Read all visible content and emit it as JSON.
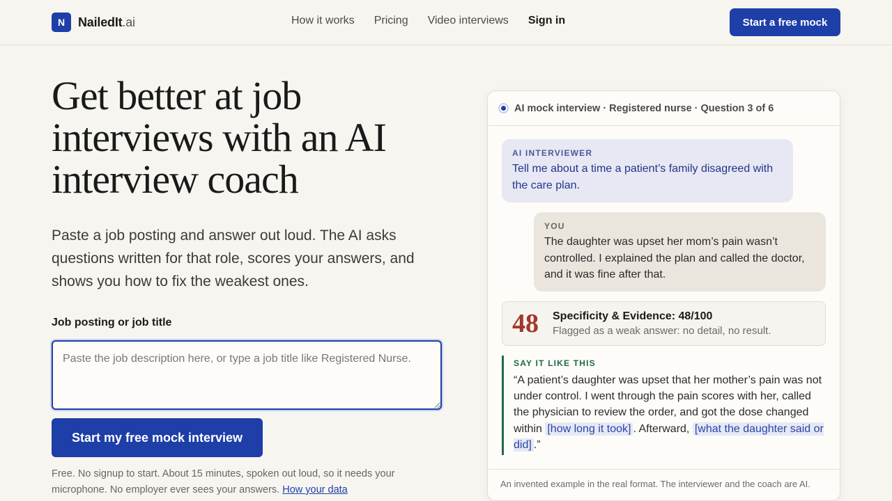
{
  "header": {
    "logo_letter": "N",
    "logo_name": "NailedIt",
    "logo_suffix": ".ai",
    "nav": [
      "How it works",
      "Pricing",
      "Video interviews",
      "Sign in"
    ],
    "cta": "Start a free mock"
  },
  "hero": {
    "title": "Get better at job interviews with an AI interview coach",
    "subtitle": "Paste a job posting and answer out loud. The AI asks questions written for that role, scores your answers, and shows you how to fix the weakest ones.",
    "field_label": "Job posting or job title",
    "input_value": "",
    "input_placeholder": "Paste the job description here, or type a job title like Registered Nurse.",
    "start_button": "Start my free mock interview",
    "fine_print": "Free. No signup to start. About 15 minutes, spoken out loud, so it needs your microphone. No employer ever sees your answers.",
    "fine_print_link": "How your data"
  },
  "card": {
    "header": "AI mock interview · Registered nurse · Question 3 of 6",
    "ai_label": "AI INTERVIEWER",
    "ai_text": "Tell me about a time a patient’s family disagreed with the care plan.",
    "you_label": "YOU",
    "you_text": "The daughter was upset her mom’s pain wasn’t controlled. I explained the plan and called the doctor, and it was fine after that.",
    "score": "48",
    "score_title": "Specificity & Evidence: 48/100",
    "score_note": "Flagged as a weak answer: no detail, no result.",
    "say_label": "SAY IT LIKE THIS",
    "say_part1": "“A patient’s daughter was upset that her mother’s pain was not under control. I went through the pain scores with her, called the physician to review the order, and got the dose changed within",
    "say_slot1": "[how long it took]",
    "say_part2": ". Afterward,",
    "say_slot2": "[what the daughter said or did]",
    "say_part3": ".”",
    "footer": "An invented example in the real format. The interviewer and the coach are AI."
  },
  "colors": {
    "brand": "#1e3ea8",
    "score": "#a3372c",
    "coach_accent": "#1f6a4a",
    "background": "#f7f5f0"
  }
}
